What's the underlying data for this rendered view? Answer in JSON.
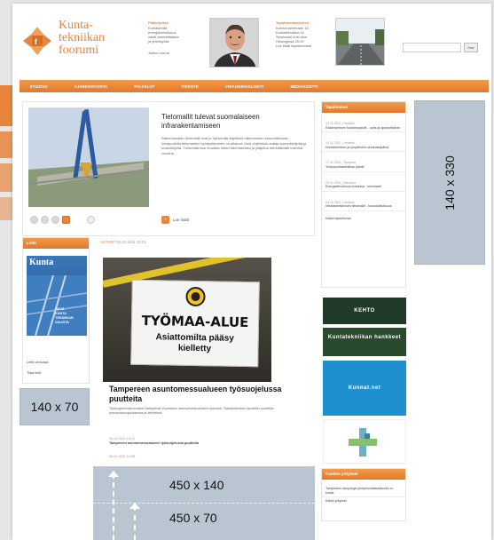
{
  "header": {
    "logo_lines": [
      "Kunta-",
      "tekniikan",
      "foorumi"
    ],
    "block1": {
      "heading": "Pääkirjoitus",
      "lines": [
        "Kuntakenttä",
        "energiatehokkuus",
        "vaatii ammattitaitoa",
        "ja yhteistyötä"
      ],
      "author": "Jukka Luoma"
    },
    "block2": {
      "heading": "Tapahtumakalenteri",
      "lines": [
        "Kunnat seminaari 15",
        "Kuntatekniikka 14.",
        "Seminaari uusi alue",
        "Helsingissä 25.09",
        "Lue lisää tapahtumista"
      ]
    },
    "search": {
      "placeholder": "",
      "button_label": "Hae"
    }
  },
  "nav": {
    "items": [
      "ETUSIVU",
      "AJANKOHTAISTA",
      "PALVELUT",
      "TIEDOTE",
      "VIRANOMAISLINKIT",
      "MEDIAKORTTI"
    ]
  },
  "feature": {
    "title": "Tietomallit tulevat suomalaiseen infrarakentamiseen",
    "text": "Rakennusalan tietomallit ovat jo nyt tutuille käytössä rakennusten suunnittelussa. Infrapuolella tietomallien hyödyntäminen on alkanut. Uusi ohjelmisto auttaa suunnittelijoita ja urakoitsijoita. Tietomallinnus muuttaa infran rakentamista ja ylläpitoa merkittävästi tulevina vuosina.",
    "more_label": "Lue lisää"
  },
  "lehti": {
    "heading": "Lehti",
    "magazine_title": "Kunta",
    "magazine_sub": [
      "HYVÄ",
      "KUNTA",
      "TEKNIIKAN",
      "VALINTA"
    ],
    "link1": "Lehti verkossa",
    "link2": "Tilaa lehti"
  },
  "news": {
    "category": "UUTISET",
    "date": "06.10.2011 13:21",
    "sign_line1": "TYÖMAA-ALUE",
    "sign_line2": [
      "Asiattomilta pääsy",
      "kielletty"
    ],
    "title": "Tampereen asuntomessualueen työsuojelussa puutteita",
    "lead": "Työsuojeluviranomaiset tarkastivat Vuoreksen asuntomessualueen työmaat. Tarkastuksissa havaittiin puutteita putoamissuojauksessa ja telineissä.",
    "items": [
      {
        "date": "06.10.2011 13:21",
        "text": "Tampereen asuntomessualueen työsuojelussa puutteita"
      },
      {
        "date": "06.10.2011 12:08",
        "text": ""
      }
    ]
  },
  "right": {
    "heading": "Tapahtumat",
    "items": [
      {
        "date": "13.11.2011 | Helsinki",
        "text": "Rakentamisen tuotantopäivät - uutta ja ajankohtaista"
      },
      {
        "date": "14.11.2011 | Helsinki",
        "text": "Kuntatekniikan ja ympäristön seminaaripäivä"
      },
      {
        "date": "17.11.2011 | Tampere",
        "text": "Yhdyskuntatekniikan päivät"
      },
      {
        "date": "22.11.2011 | Tampere",
        "text": "Energiatehokkuus kunnissa - seminaari"
      },
      {
        "date": "24.11.2011 | Helsinki",
        "text": "Infrarakentamisen tietomallit - koulutustilaisuus"
      }
    ],
    "more": "Kaikki tapahtumat",
    "ads": [
      "KEHTO",
      "Kuntatekniikan hankkeet",
      "Kunnat.net",
      ""
    ],
    "bottom_heading": "Kuntien yritykset",
    "bottom_items": [
      "Tampereen kaupungin yhdyskuntalautakunta on koolla"
    ],
    "bottom_more": "Kaikki yritykset"
  },
  "placeholders": {
    "right": "140 x 330",
    "left": "140 x 70",
    "bottom1": "450 x 140",
    "bottom2": "450 x 70"
  }
}
